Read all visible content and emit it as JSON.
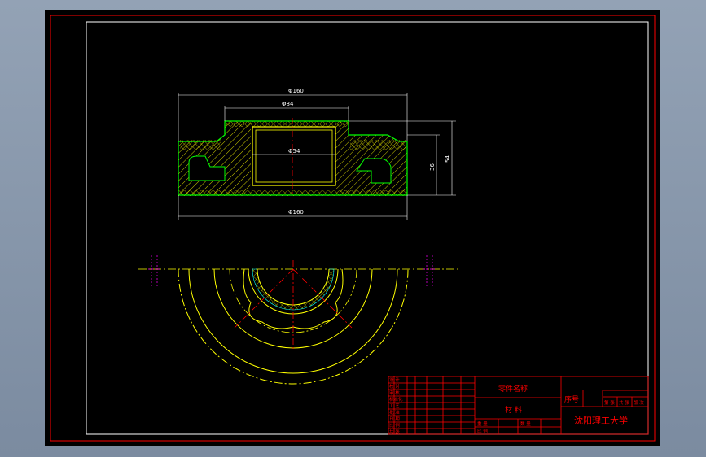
{
  "drawing": {
    "dimensions": {
      "top_overall": "Φ160",
      "top_inner": "Φ84",
      "bore": "Φ54",
      "bottom_overall": "Φ160",
      "right_inner_height": "36",
      "right_overall_height": "54"
    }
  },
  "title_block": {
    "part_name": "零件名称",
    "material": "材  料",
    "serial": "序号",
    "university": "沈阳理工大学",
    "left_rows": [
      "设 计",
      "校 对",
      "审 核",
      "标准化",
      "工 艺",
      "批 准",
      "日 期",
      "比 例",
      "共 张"
    ],
    "sheet_cells": [
      "第 张",
      "共 张",
      "版 次"
    ],
    "bottom_cells": [
      "重 量",
      "数 量",
      "比 例"
    ]
  },
  "colors": {
    "background": "#000000",
    "outline": "#00ff00",
    "hatch": "#ffff00",
    "border": "#ff0000",
    "frame": "#ffffff",
    "centerline": "#ff0000",
    "dimension": "#ffffff"
  }
}
